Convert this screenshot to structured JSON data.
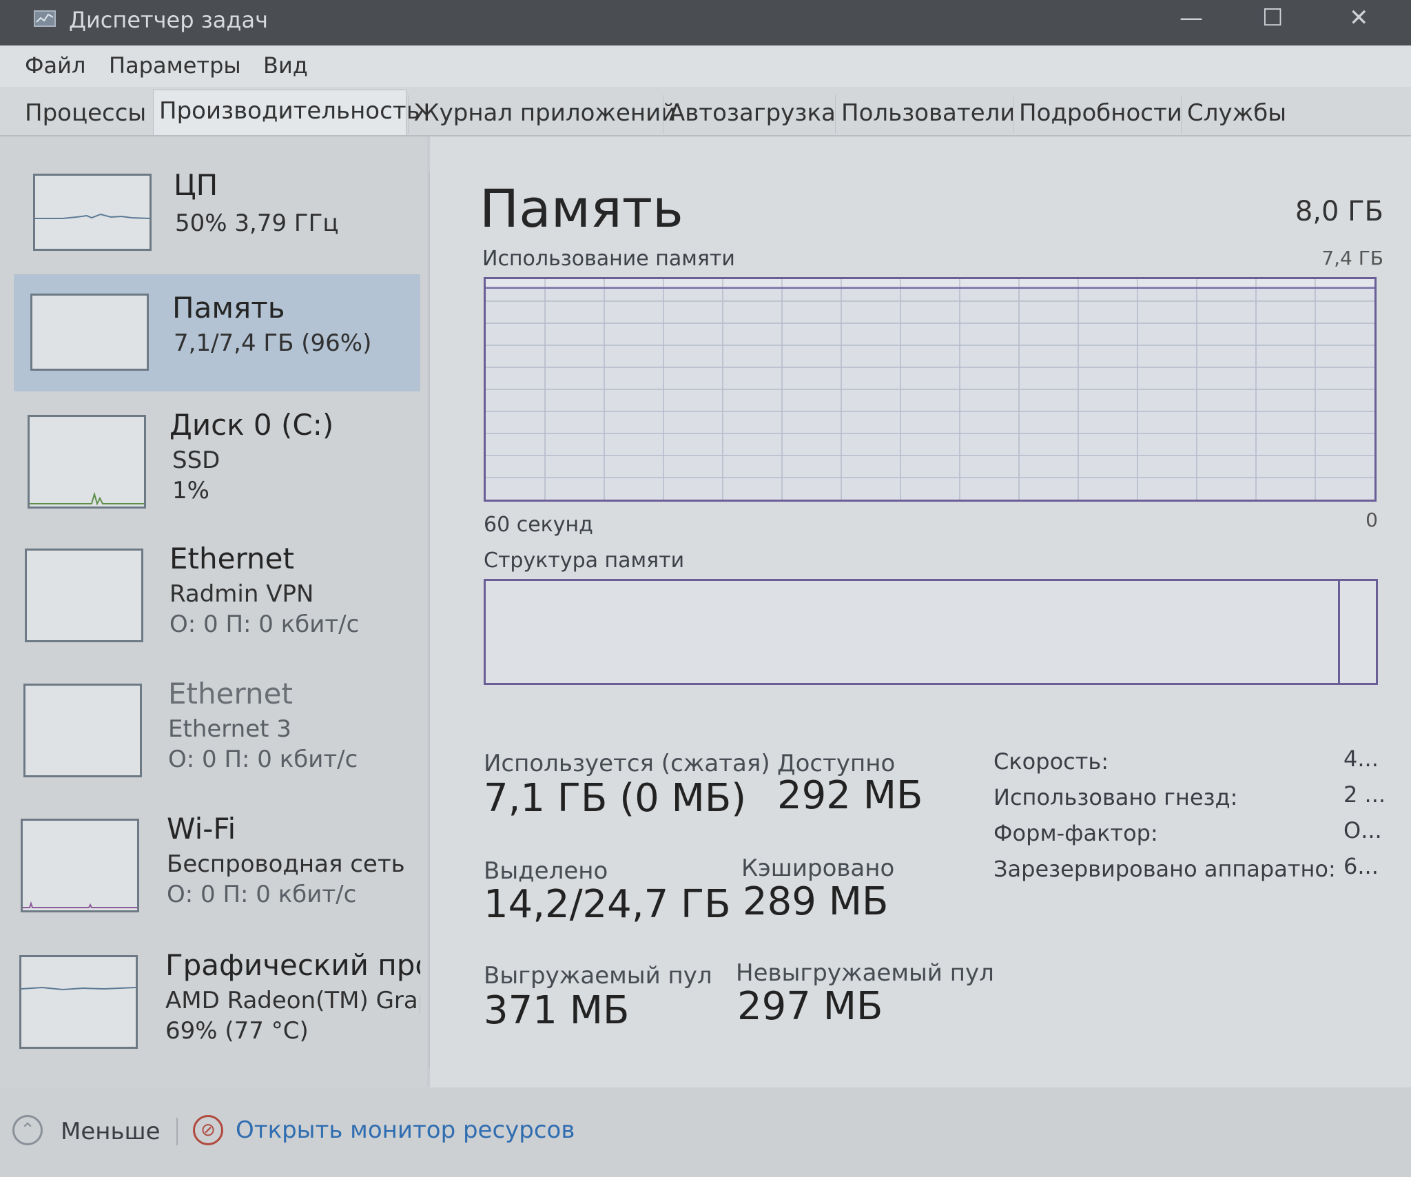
{
  "window": {
    "title": "Диспетчер задач"
  },
  "menu": {
    "items": [
      "Файл",
      "Параметры",
      "Вид"
    ]
  },
  "tabs": [
    "Процессы",
    "Производительность",
    "Журнал приложений",
    "Автозагрузка",
    "Пользователи",
    "Подробности",
    "Службы"
  ],
  "sidebar": {
    "items": [
      {
        "title": "ЦП",
        "line1": "50% 3,79 ГГц",
        "line2": ""
      },
      {
        "title": "Память",
        "line1": "7,1/7,4 ГБ (96%)",
        "line2": ""
      },
      {
        "title": "Диск 0 (C:)",
        "line1": "SSD",
        "line2": "1%"
      },
      {
        "title": "Ethernet",
        "line1": "Radmin VPN",
        "line2": "О: 0 П: 0 кбит/с"
      },
      {
        "title": "Ethernet",
        "line1": "Ethernet 3",
        "line2": "О: 0 П: 0 кбит/с"
      },
      {
        "title": "Wi-Fi",
        "line1": "Беспроводная сеть",
        "line2": "О: 0 П: 0 кбит/с"
      },
      {
        "title": "Графический про",
        "line1": "AMD Radeon(TM) Graph",
        "line2": "69% (77 °C)"
      }
    ]
  },
  "memory": {
    "title": "Память",
    "total": "8,0 ГБ",
    "usage_label": "Использование памяти",
    "usage_max": "7,4 ГБ",
    "time_left": "60 секунд",
    "time_right": "0",
    "structure_label": "Структура памяти",
    "usage_fraction": 0.96,
    "stats": {
      "in_use_label": "Используется (сжатая)",
      "in_use_value": "7,1 ГБ (0 МБ)",
      "available_label": "Доступно",
      "available_value": "292 МБ",
      "committed_label": "Выделено",
      "committed_value": "14,2/24,7 ГБ",
      "cached_label": "Кэшировано",
      "cached_value": "289 МБ",
      "paged_label": "Выгружаемый пул",
      "paged_value": "371 МБ",
      "nonpaged_label": "Невыгружаемый пул",
      "nonpaged_value": "297 МБ"
    },
    "properties": [
      {
        "label": "Скорость:",
        "value": "4..."
      },
      {
        "label": "Использовано гнезд:",
        "value": "2 ..."
      },
      {
        "label": "Форм-фактор:",
        "value": "О..."
      },
      {
        "label": "Зарезервировано аппаратно:",
        "value": "6..."
      }
    ]
  },
  "footer": {
    "less_label": "Меньше",
    "monitor_label": "Открыть монитор ресурсов"
  }
}
